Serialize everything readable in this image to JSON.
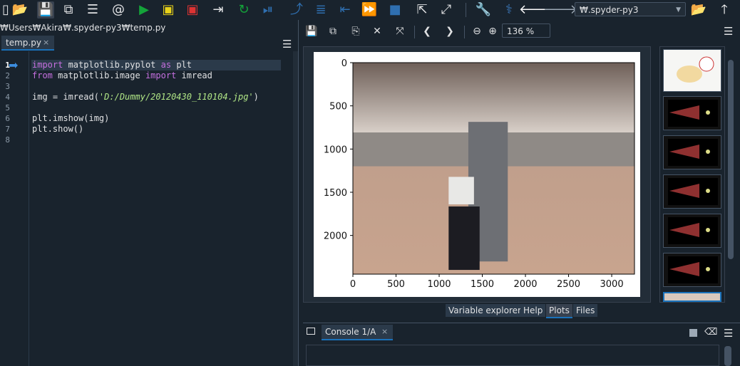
{
  "toolbar": {
    "icons": [
      "open-folder-icon",
      "save-icon",
      "save-all-icon",
      "outline-icon",
      "at-icon",
      "run-icon",
      "run-cell-icon",
      "run-cell-advance-icon",
      "run-selection-icon",
      "rerun-icon",
      "debug-icon",
      "step-icon",
      "step-into-icon",
      "step-return-icon",
      "continue-icon",
      "stop-icon",
      "maximize-icon",
      "fullscreen-icon",
      "wrench-icon",
      "python-icon",
      "back-icon",
      "forward-icon",
      "open-env-icon",
      "up-icon"
    ],
    "environment": "₩.spyder-py3"
  },
  "path_bar": {
    "path": "₩Users₩Akira₩.spyder-py3₩temp.py"
  },
  "editor": {
    "tab_label": "temp.py",
    "tab_close": "×",
    "line_numbers": [
      "1",
      "2",
      "3",
      "4",
      "5",
      "6",
      "7",
      "8"
    ],
    "lines": {
      "l1_kw1": "import",
      "l1_mid": " matplotlib.pyplot ",
      "l1_kw2": "as",
      "l1_end": " plt",
      "l2_kw1": "from",
      "l2_mid": " matplotlib.image ",
      "l2_kw2": "import",
      "l2_end": " imread",
      "l4_start": "img = imread(",
      "l4_str": "'D:/Dummy/20120430_110104.jpg'",
      "l4_end": ")",
      "l6": "plt.imshow(img)",
      "l7": "plt.show()"
    }
  },
  "plots": {
    "zoom": "136 %",
    "tabs": [
      "Variable explorer",
      "Help",
      "Plots",
      "Files"
    ],
    "active_tab": "Plots"
  },
  "console": {
    "tab_label": "Console 1/A",
    "tab_close": "×"
  },
  "chart_data": {
    "type": "image",
    "xticks": [
      0,
      500,
      1000,
      1500,
      2000,
      2500,
      3000
    ],
    "yticks": [
      0,
      500,
      1000,
      1500,
      2000
    ],
    "xlim": [
      0,
      3264
    ],
    "ylim": [
      2448,
      0
    ]
  },
  "colors": {
    "accent": "#1a72bb",
    "background": "#19232d",
    "keyword": "#c670e0",
    "string": "#b0e686"
  }
}
